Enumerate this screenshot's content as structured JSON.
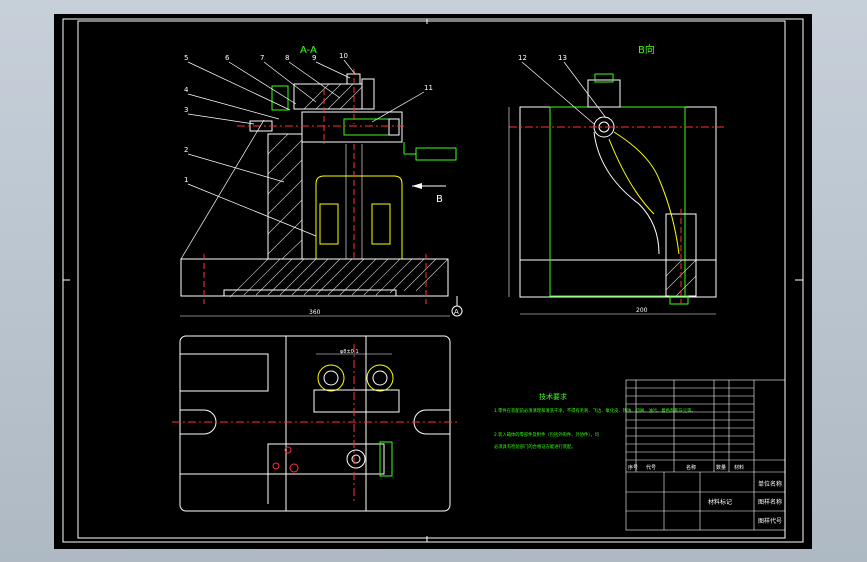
{
  "drawing": {
    "section_title": "A-A",
    "view_title": "B向",
    "view_arrow_letter": "B",
    "callouts": [
      "5",
      "6",
      "7",
      "8",
      "9",
      "10",
      "4",
      "3",
      "11",
      "2",
      "1",
      "12",
      "13"
    ],
    "datum_label": "A",
    "dimensions": {
      "base_width": "360",
      "right_width": "200",
      "top_slot": "φ8±0.1"
    },
    "tech_requirements": {
      "title": "技术要求",
      "items": [
        "1.零件在装配前必须清理和清洗干净，不得有毛刺、飞边、氧化皮、锈蚀、切屑、油污、着色剂和灰尘等。",
        "2.装入箱体的零部件及附件（包括外购件、外协件），均",
        "必须具有检验部门的合格证方能进行装配。"
      ]
    },
    "title_block": {
      "header": [
        "序号",
        "代号",
        "名称",
        "数量",
        "材料"
      ],
      "unit_name": "单位名称",
      "drawing_name": "图样名称",
      "drawing_code": "图样代号",
      "material_mark": "材料标记"
    }
  },
  "colors": {
    "background": "#000000",
    "line": "#ffffff",
    "green": "#39ff14",
    "yellow": "#ffff00",
    "red": "#ff3030",
    "cyan": "#00ffff"
  }
}
